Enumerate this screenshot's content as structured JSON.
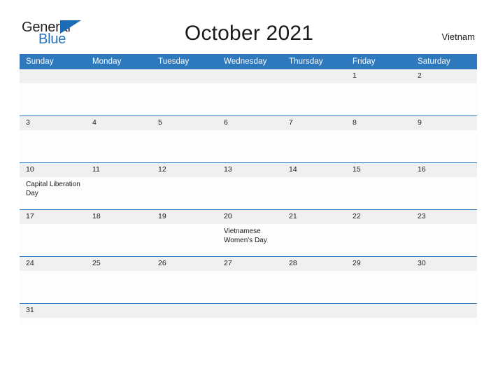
{
  "brand": {
    "name_part1": "General",
    "name_part2": "Blue",
    "flag_icon": "blue-triangle-flag-icon"
  },
  "header": {
    "title": "October 2021",
    "country": "Vietnam"
  },
  "colors": {
    "header_blue": "#2e78bd",
    "logo_blue": "#2272b9",
    "day_band_gray": "#f0f0f0",
    "cell_background": "#fdfdfd",
    "page_background": "#ffffff",
    "text": "#1a1a1a"
  },
  "calendar": {
    "month": "October",
    "year": "2021",
    "weekday_headers": [
      "Sunday",
      "Monday",
      "Tuesday",
      "Wednesday",
      "Thursday",
      "Friday",
      "Saturday"
    ],
    "weeks": [
      [
        {
          "day": "",
          "holiday": ""
        },
        {
          "day": "",
          "holiday": ""
        },
        {
          "day": "",
          "holiday": ""
        },
        {
          "day": "",
          "holiday": ""
        },
        {
          "day": "",
          "holiday": ""
        },
        {
          "day": "1",
          "holiday": ""
        },
        {
          "day": "2",
          "holiday": ""
        }
      ],
      [
        {
          "day": "3",
          "holiday": ""
        },
        {
          "day": "4",
          "holiday": ""
        },
        {
          "day": "5",
          "holiday": ""
        },
        {
          "day": "6",
          "holiday": ""
        },
        {
          "day": "7",
          "holiday": ""
        },
        {
          "day": "8",
          "holiday": ""
        },
        {
          "day": "9",
          "holiday": ""
        }
      ],
      [
        {
          "day": "10",
          "holiday": "Capital Liberation Day"
        },
        {
          "day": "11",
          "holiday": ""
        },
        {
          "day": "12",
          "holiday": ""
        },
        {
          "day": "13",
          "holiday": ""
        },
        {
          "day": "14",
          "holiday": ""
        },
        {
          "day": "15",
          "holiday": ""
        },
        {
          "day": "16",
          "holiday": ""
        }
      ],
      [
        {
          "day": "17",
          "holiday": ""
        },
        {
          "day": "18",
          "holiday": ""
        },
        {
          "day": "19",
          "holiday": ""
        },
        {
          "day": "20",
          "holiday": "Vietnamese Women's Day"
        },
        {
          "day": "21",
          "holiday": ""
        },
        {
          "day": "22",
          "holiday": ""
        },
        {
          "day": "23",
          "holiday": ""
        }
      ],
      [
        {
          "day": "24",
          "holiday": ""
        },
        {
          "day": "25",
          "holiday": ""
        },
        {
          "day": "26",
          "holiday": ""
        },
        {
          "day": "27",
          "holiday": ""
        },
        {
          "day": "28",
          "holiday": ""
        },
        {
          "day": "29",
          "holiday": ""
        },
        {
          "day": "30",
          "holiday": ""
        }
      ],
      [
        {
          "day": "31",
          "holiday": ""
        },
        {
          "day": "",
          "holiday": ""
        },
        {
          "day": "",
          "holiday": ""
        },
        {
          "day": "",
          "holiday": ""
        },
        {
          "day": "",
          "holiday": ""
        },
        {
          "day": "",
          "holiday": ""
        },
        {
          "day": "",
          "holiday": ""
        }
      ]
    ]
  }
}
